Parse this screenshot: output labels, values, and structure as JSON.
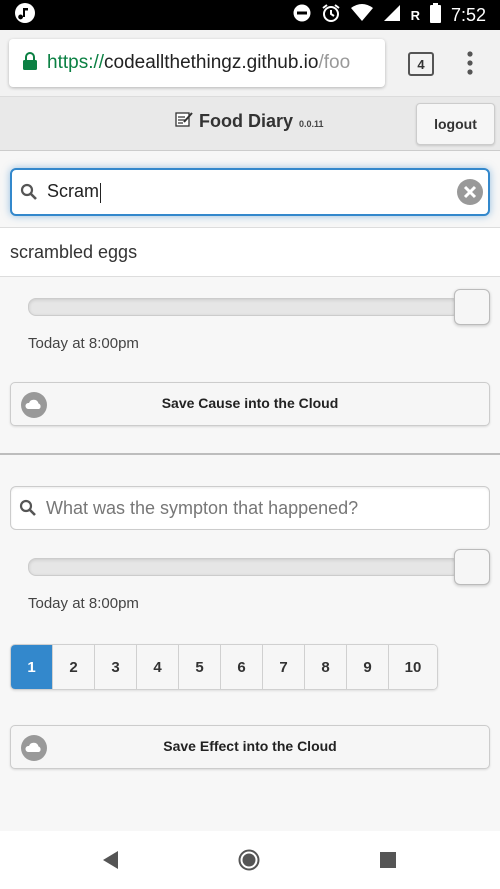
{
  "status_bar": {
    "time": "7:52",
    "carrier_badge": "R",
    "icons": [
      "music-note-icon",
      "do-not-disturb-icon",
      "alarm-icon",
      "wifi-icon",
      "signal-icon",
      "battery-icon"
    ]
  },
  "browser": {
    "url_scheme": "https://",
    "url_host": "codeallthethingz.github.io",
    "url_path": "/foo",
    "tab_count": "4",
    "icons": [
      "lock-icon",
      "more-vert-icon"
    ]
  },
  "app": {
    "title": "Food Diary",
    "version": "0.0.11",
    "logout_label": "logout",
    "title_icon": "notepad-icon"
  },
  "cause": {
    "search_value": "Scram",
    "results": [
      "scrambled eggs"
    ],
    "slider_value": 1.0,
    "time_label": "Today at 8:00pm",
    "save_label": "Save Cause into the Cloud"
  },
  "effect": {
    "search_placeholder": "What was the sympton that happened?",
    "slider_value": 1.0,
    "time_label": "Today at 8:00pm",
    "severity_options": [
      "1",
      "2",
      "3",
      "4",
      "5",
      "6",
      "7",
      "8",
      "9",
      "10"
    ],
    "severity_selected": "1",
    "save_label": "Save Effect into the Cloud"
  },
  "colors": {
    "accent": "#3388cc",
    "url_secure": "#0b8043"
  }
}
